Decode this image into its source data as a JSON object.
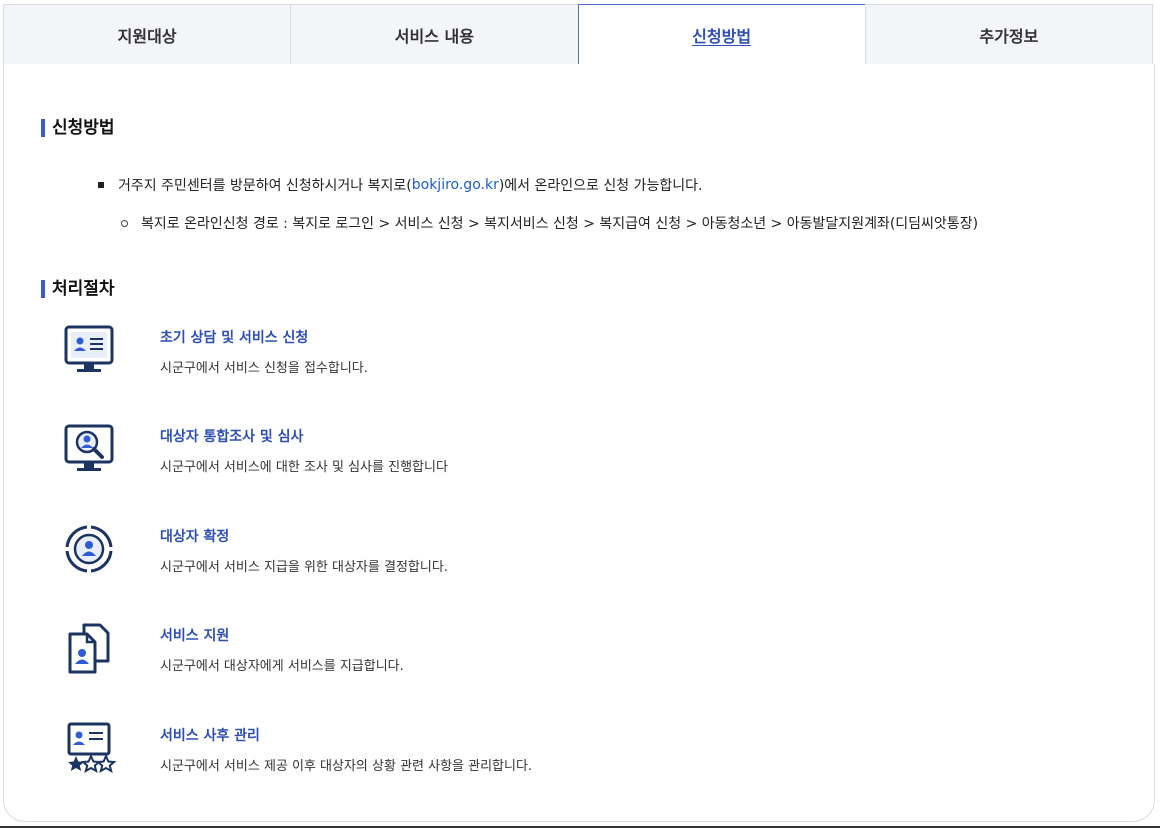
{
  "tabs": [
    {
      "label": "지원대상"
    },
    {
      "label": "서비스 내용"
    },
    {
      "label": "신청방법"
    },
    {
      "label": "추가정보"
    }
  ],
  "apply": {
    "title": "신청방법",
    "line1_pre": "거주지 주민센터를 방문하여 신청하시거나 복지로(",
    "line1_link": "bokjiro.go.kr",
    "line1_post": ")에서 온라인으로 신청 가능합니다.",
    "line2": "복지로 온라인신청 경로 : 복지로 로그인 > 서비스 신청 > 복지서비스 신청 > 복지급여 신청 > 아동청소년 > 아동발달지원계좌(디딤씨앗통장)"
  },
  "process": {
    "title": "처리절차",
    "steps": [
      {
        "title": "초기 상담 및 서비스 신청",
        "desc": "시군구에서 서비스 신청을 접수합니다.",
        "icon": "monitor-profile-icon"
      },
      {
        "title": "대상자 통합조사 및 심사",
        "desc": "시군구에서 서비스에 대한 조사 및 심사를 진행합니다",
        "icon": "monitor-search-icon"
      },
      {
        "title": "대상자 확정",
        "desc": "시군구에서 서비스 지급을 위한 대상자를 결정합니다.",
        "icon": "target-person-icon"
      },
      {
        "title": "서비스 지원",
        "desc": "시군구에서 대상자에게 서비스를 지급합니다.",
        "icon": "documents-person-icon"
      },
      {
        "title": "서비스 사후 관리",
        "desc": "시군구에서 서비스 제공 이후 대상자의 상황 관련 사항을 관리합니다.",
        "icon": "profile-rating-icon"
      }
    ]
  },
  "colors": {
    "accent": "#2d4fb3",
    "icon_navy": "#1c3462",
    "icon_blue": "#2f5bd6",
    "link": "#1b5fc4"
  }
}
